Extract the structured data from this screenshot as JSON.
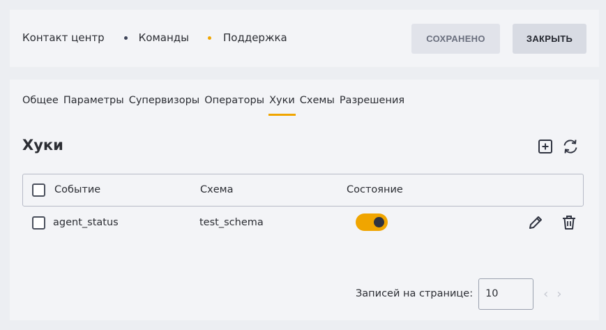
{
  "header": {
    "breadcrumb": [
      "Контакт центр",
      "Команды",
      "Поддержка"
    ],
    "saved_label": "СОХРАНЕНО",
    "close_label": "ЗАКРЫТЬ"
  },
  "tabs": [
    {
      "label": "Общее"
    },
    {
      "label": "Параметры"
    },
    {
      "label": "Супервизоры"
    },
    {
      "label": "Операторы"
    },
    {
      "label": "Хуки"
    },
    {
      "label": "Схемы"
    },
    {
      "label": "Разрешения"
    }
  ],
  "active_tab": "Хуки",
  "section": {
    "title": "Хуки",
    "add_icon": "plus-square-icon",
    "refresh_icon": "refresh-icon"
  },
  "table": {
    "columns": [
      "Событие",
      "Схема",
      "Состояние"
    ],
    "rows": [
      {
        "event": "agent_status",
        "schema": "test_schema",
        "enabled": true
      }
    ]
  },
  "pagination": {
    "label": "Записей на странице:",
    "per_page": "10"
  },
  "colors": {
    "accent": "#f0a500",
    "background": "#eceef2",
    "card": "#f3f4f7"
  }
}
